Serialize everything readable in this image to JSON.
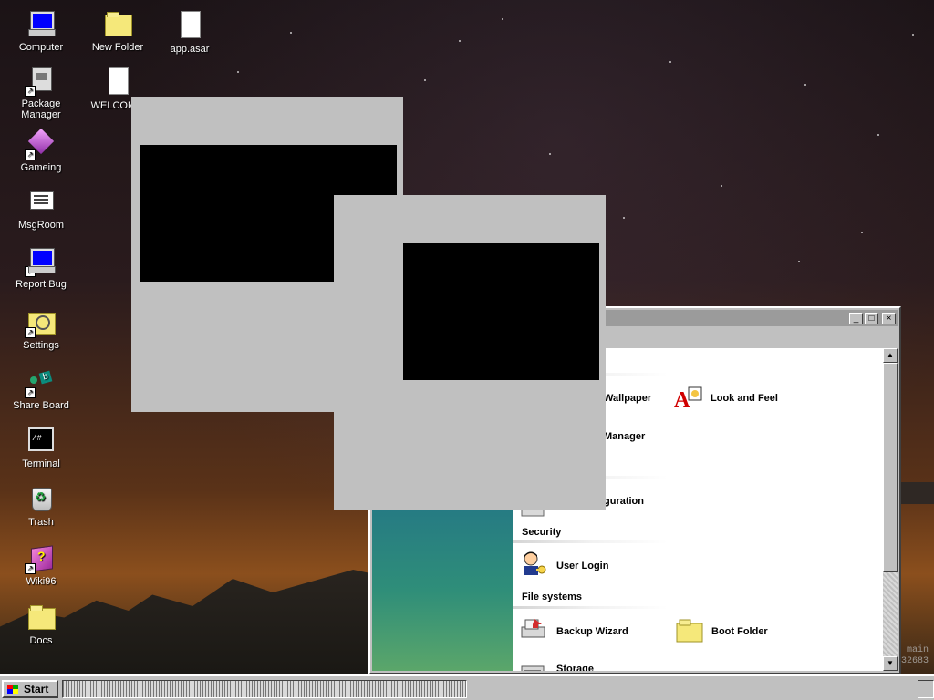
{
  "desktop": {
    "icons": [
      {
        "label": "Computer",
        "icon": "computer-icon"
      },
      {
        "label": "New Folder",
        "icon": "folder-icon"
      },
      {
        "label": "app.asar",
        "icon": "file-icon"
      },
      {
        "label": "Package Manager",
        "icon": "package-icon"
      },
      {
        "label": "WELCOM d",
        "icon": "markdown-file-icon"
      },
      {
        "label": "Gameing",
        "icon": "cube-icon"
      },
      {
        "label": "MsgRoom",
        "icon": "message-icon"
      },
      {
        "label": "Report Bug",
        "icon": "monitor-icon"
      },
      {
        "label": "Settings",
        "icon": "settings-folder-icon"
      },
      {
        "label": "Share Board",
        "icon": "share-board-icon"
      },
      {
        "label": "Terminal",
        "icon": "terminal-icon"
      },
      {
        "label": "Trash",
        "icon": "trash-icon"
      },
      {
        "label": "Wiki96",
        "icon": "wiki-book-icon"
      },
      {
        "label": "Docs",
        "icon": "folder-icon"
      }
    ]
  },
  "control_panel": {
    "sections": {
      "security": "Security",
      "file_systems": "File systems"
    },
    "items": {
      "wallpaper": "Wallpaper",
      "look_and_feel": "Look and Feel",
      "manager": "Manager",
      "configuration": "guration",
      "user_login": "User Login",
      "backup_wizard": "Backup Wizard",
      "boot_folder": "Boot Folder",
      "storage": "Storage"
    }
  },
  "taskbar": {
    "start_label": "Start"
  },
  "watermark": {
    "line1": "main",
    "line2": "32683"
  },
  "icons": {
    "minimize": "minimize-icon",
    "maximize": "maximize-icon",
    "close": "close-icon",
    "scroll_up": "scroll-up-icon",
    "scroll_down": "scroll-down-icon"
  }
}
